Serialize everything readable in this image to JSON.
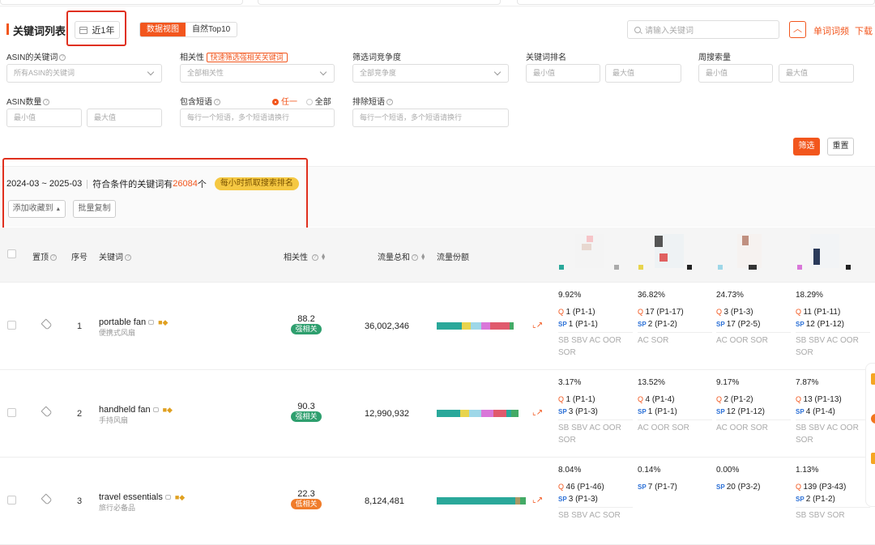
{
  "header": {
    "title": "关键词列表",
    "date_range_btn": "近1年",
    "view_tabs": [
      "数据视图",
      "自然Top10"
    ],
    "search_placeholder": "请输入关键词",
    "links": [
      "单词词频",
      "下载"
    ]
  },
  "filters": {
    "asin_keyword": {
      "label": "ASIN的关键词",
      "value": "所有ASIN的关键词"
    },
    "relevance": {
      "label": "相关性",
      "quick_tag": "快速筛选强相关关键词",
      "value": "全部相关性"
    },
    "competition": {
      "label": "筛选词竞争度",
      "value": "全部竞争度"
    },
    "rank": {
      "label": "关键词排名",
      "min": "最小值",
      "max": "最大值"
    },
    "weekly": {
      "label": "周搜索量",
      "min": "最小值",
      "max": "最大值"
    },
    "asin_count": {
      "label": "ASIN数量",
      "min": "最小值",
      "max": "最大值"
    },
    "include": {
      "label": "包含短语",
      "opt_any": "任一",
      "opt_all": "全部",
      "placeholder": "每行一个短语，多个短语请换行"
    },
    "exclude": {
      "label": "排除短语",
      "placeholder": "每行一个短语，多个短语请换行"
    },
    "filter_btn": "筛选",
    "reset_btn": "重置"
  },
  "summary": {
    "range": "2024-03 ~ 2025-03",
    "text_pre": "符合条件的关键词有",
    "count": "26084",
    "text_post": "个",
    "badge": "每小时抓取搜索排名",
    "add_fav": "添加收藏到",
    "batch_copy": "批量复制"
  },
  "table": {
    "headers": {
      "pin": "置顶",
      "idx": "序号",
      "kw": "关键词",
      "rel": "相关性",
      "traffic": "流量总和",
      "share": "流量份额"
    },
    "rows": [
      {
        "idx": "1",
        "kw": "portable fan",
        "cn": "便携式风扇",
        "rel": "88.2",
        "tag": "强相关",
        "tag_color": "#2e9f6e",
        "traffic": "36,002,346",
        "share": [
          [
            28,
            "#2aa89a"
          ],
          [
            10,
            "#e8d44d"
          ],
          [
            12,
            "#9ed7e8"
          ],
          [
            10,
            "#d977d9"
          ],
          [
            14,
            "#e05a6d"
          ],
          [
            8,
            "#e05a6d"
          ],
          [
            4,
            "#44aa66"
          ]
        ],
        "cells": [
          {
            "pct": "9.92%",
            "a": "1 (P1-1)",
            "sp": "1 (P1-1)",
            "pl": "SB SBV AC OOR SOR"
          },
          {
            "pct": "36.82%",
            "a": "17 (P1-17)",
            "sp": "2 (P1-2)",
            "pl": "AC SOR"
          },
          {
            "pct": "24.73%",
            "a": "3 (P1-3)",
            "sp": "17 (P2-5)",
            "pl": "AC OOR SOR"
          },
          {
            "pct": "18.29%",
            "a": "11 (P1-11)",
            "sp": "12 (P1-12)",
            "pl": "SB SBV AC OOR SOR"
          }
        ]
      },
      {
        "idx": "2",
        "kw": "handheld fan",
        "cn": "手持风扇",
        "rel": "90.3",
        "tag": "强相关",
        "tag_color": "#2e9f6e",
        "traffic": "12,990,932",
        "share": [
          [
            26,
            "#2aa89a"
          ],
          [
            10,
            "#e8d44d"
          ],
          [
            14,
            "#9ed7e8"
          ],
          [
            14,
            "#d977d9"
          ],
          [
            14,
            "#e05a6d"
          ],
          [
            6,
            "#2aa89a"
          ],
          [
            8,
            "#44aa66"
          ]
        ],
        "cells": [
          {
            "pct": "3.17%",
            "a": "1 (P1-1)",
            "sp": "3 (P1-3)",
            "pl": "SB SBV AC OOR SOR"
          },
          {
            "pct": "13.52%",
            "a": "4 (P1-4)",
            "sp": "1 (P1-1)",
            "pl": "AC OOR SOR"
          },
          {
            "pct": "9.17%",
            "a": "2 (P1-2)",
            "sp": "12 (P1-12)",
            "pl": "AC OOR SOR"
          },
          {
            "pct": "7.87%",
            "a": "13 (P1-13)",
            "sp": "4 (P1-4)",
            "pl": "SB SBV AC OOR SOR"
          }
        ]
      },
      {
        "idx": "3",
        "kw": "travel essentials",
        "cn": "旅行必备品",
        "rel": "22.3",
        "tag": "低相关",
        "tag_color": "#f07c2a",
        "traffic": "8,124,481",
        "share": [
          [
            88,
            "#2aa89a"
          ],
          [
            6,
            "#aa9966"
          ],
          [
            6,
            "#44aa66"
          ]
        ],
        "cells": [
          {
            "pct": "8.04%",
            "a": "46 (P1-46)",
            "sp": "3 (P1-3)",
            "pl": "SB SBV AC SOR"
          },
          {
            "pct": "0.14%",
            "a": "",
            "sp": "7 (P1-7)",
            "pl": ""
          },
          {
            "pct": "0.00%",
            "a": "",
            "sp": "20 (P3-2)",
            "pl": ""
          },
          {
            "pct": "1.13%",
            "a": "139 (P3-43)",
            "sp": "2 (P1-2)",
            "pl": "SB SBV SOR"
          }
        ]
      }
    ]
  }
}
